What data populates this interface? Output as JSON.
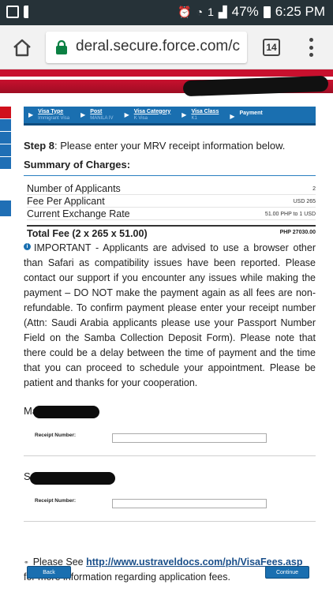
{
  "status_bar": {
    "battery": "47%",
    "time": "6:25 PM",
    "sim_label": "1"
  },
  "browser": {
    "url": "deral.secure.force.com/c",
    "tab_count": "14"
  },
  "steps": [
    {
      "title": "Visa Type",
      "subtitle": "Immigrant Visa"
    },
    {
      "title": "Post",
      "subtitle": "MANILA IV"
    },
    {
      "title": "Visa Category",
      "subtitle": "K Visa"
    },
    {
      "title": "Visa Class",
      "subtitle": "K1"
    },
    {
      "title": "Payment",
      "subtitle": ""
    }
  ],
  "step_line": {
    "prefix": "Step 8",
    "text": ": Please enter your MRV receipt information below."
  },
  "summary": {
    "title": "Summary of Charges:",
    "rows": [
      {
        "label": "Number of Applicants",
        "value": "2"
      },
      {
        "label": "Fee Per Applicant",
        "value": "USD 265"
      },
      {
        "label": "Current Exchange Rate",
        "value": "51.00 PHP to 1 USD"
      }
    ],
    "total_label": "Total Fee (2 x 265 x 51.00)",
    "total_value": "PHP 27030.00"
  },
  "notice": "IMPORTANT - Applicants are advised to use a browser other than Safari as compatibility issues have been reported. Please contact our support if you encounter any issues while making the payment – DO NOT make the payment again as all fees are non-refundable. To confirm payment please enter your receipt number (Attn: Saudi Arabia applicants please use your Passport Number Field on the Samba Collection Deposit Form). Please note that there could be a delay between the time of payment and the time that you can proceed to schedule your appointment. Please be patient and thanks for your cooperation.",
  "applicants": [
    {
      "name_visible": "Ma",
      "receipt_label": "Receipt Number:",
      "receipt_value": ""
    },
    {
      "name_visible": "S",
      "receipt_label": "Receipt Number:",
      "receipt_value": ""
    }
  ],
  "see_more": {
    "prefix": "Please See ",
    "link": "http://www.ustraveldocs.com/ph/VisaFees.asp",
    "suffix": "for more information regarding application fees."
  },
  "buttons": {
    "back": "Back",
    "continue": "Continue"
  }
}
